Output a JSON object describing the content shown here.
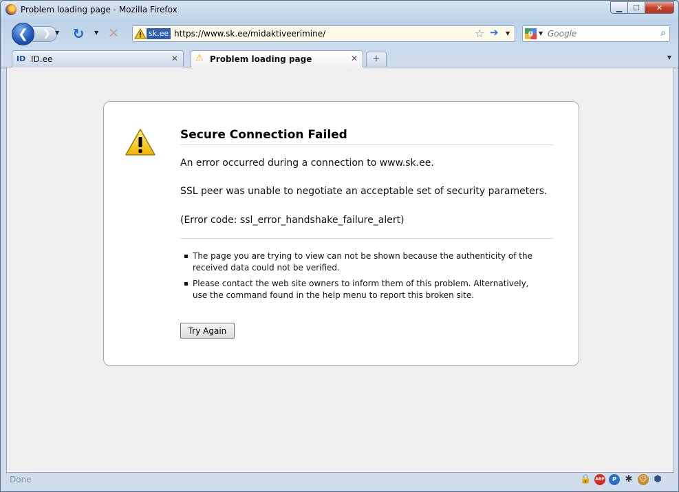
{
  "window": {
    "title": "Problem loading page - Mozilla Firefox",
    "controls": {
      "minimize": "▁",
      "maximize": "☐",
      "close": "✕"
    }
  },
  "navbar": {
    "back": "❮",
    "forward": "❯",
    "reload": "↻",
    "stop": "✕",
    "dropdown": "▼",
    "site_identity": "sk.ee",
    "url": "https://www.sk.ee/midaktiveerimine/",
    "search_placeholder": "Google",
    "icons": {
      "site_warning": "warning-triangle-icon",
      "bookmark": "star-icon",
      "go": "arrow-right-icon",
      "search": "magnifier-icon"
    }
  },
  "tabs": [
    {
      "favicon": "ID",
      "title": "ID.ee",
      "close": "✕"
    },
    {
      "favicon": "⚠",
      "title": "Problem loading page",
      "close": "✕",
      "active": true
    }
  ],
  "newtab": "+",
  "error": {
    "title": "Secure Connection Failed",
    "line1": "An error occurred during a connection to www.sk.ee.",
    "line2": "SSL peer was unable to negotiate an acceptable set of security parameters.",
    "line3": "(Error code: ssl_error_handshake_failure_alert)",
    "bullets": [
      "The page you are trying to view can not be shown because the authenticity of the received data could not be verified.",
      "Please contact the web site owners to inform them of this problem. Alternatively, use the command found in the help menu to report this broken site."
    ],
    "button": "Try Again"
  },
  "status": {
    "text": "Done",
    "icons": [
      "lock-icon",
      "adblock-plus-icon",
      "pp-icon",
      "firebug-icon",
      "greasemonkey-icon",
      "shield-icon"
    ],
    "abp_label": "ABP",
    "pp_label": "P"
  },
  "colors": {
    "accent": "#2166c8",
    "warning": "#f1c40f",
    "site_identity_bg": "#2e5db3"
  }
}
